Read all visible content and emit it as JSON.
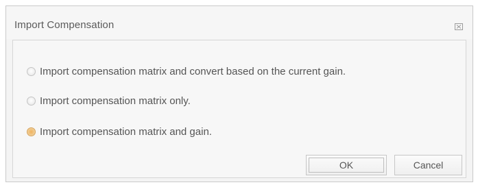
{
  "dialog": {
    "title": "Import Compensation",
    "close_icon": "close-icon"
  },
  "options": [
    {
      "label": "Import compensation matrix and convert based on the current gain.",
      "selected": false
    },
    {
      "label": "Import compensation matrix only.",
      "selected": false
    },
    {
      "label": "Import compensation matrix and gain.",
      "selected": true
    }
  ],
  "buttons": {
    "ok_label": "OK",
    "cancel_label": "Cancel"
  },
  "colors": {
    "selected_radio": "#f1b25e",
    "border": "#c9c9c9",
    "background": "#f4f4f4"
  }
}
